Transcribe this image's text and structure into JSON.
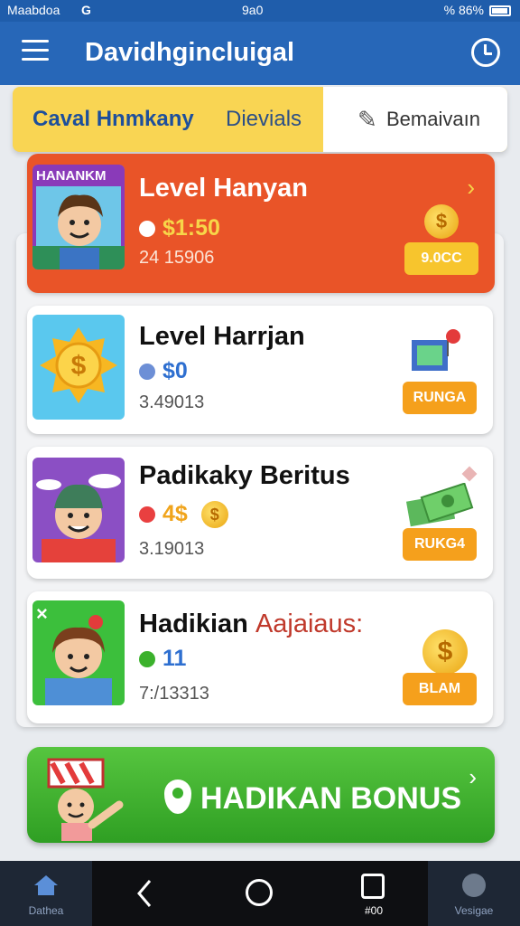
{
  "status_bar": {
    "carrier": "Maabdoa",
    "g": "G",
    "time": "9a0",
    "indicators": "% 86%"
  },
  "app_bar": {
    "title": "Davidhgincluigal"
  },
  "tabs": [
    {
      "label": "Caval Hnmkany"
    },
    {
      "label": "Dievials"
    },
    {
      "label": "Bemaivaın"
    }
  ],
  "featured": {
    "thumb_label": "HANANKM",
    "title": "Level Hanyan",
    "reward": "$1:50",
    "count": "24 15906",
    "action": "9.0CC"
  },
  "cards": [
    {
      "title": "Level Harrjan",
      "reward": "$0",
      "count": "3.49013",
      "action": "RUNGA"
    },
    {
      "title": "Padikaky Beritus",
      "reward": "4$",
      "count": "3.19013",
      "action": "RUKG4"
    },
    {
      "title": "Hadikian",
      "title_accent": "Aajaiaus:",
      "reward": "11",
      "count": "7:/13313",
      "action": "BLAM"
    }
  ],
  "bonus": {
    "label": "HADIKAN BONUS"
  },
  "nav": {
    "home_label": "Dathea",
    "recent_label": "#00",
    "voice_label": "Vesigae"
  },
  "colors": {
    "app_bar": "#2767b8",
    "featured": "#e95428",
    "action": "#f5a01c",
    "bonus": "#3bb12c",
    "tabs": "#f9d553"
  }
}
